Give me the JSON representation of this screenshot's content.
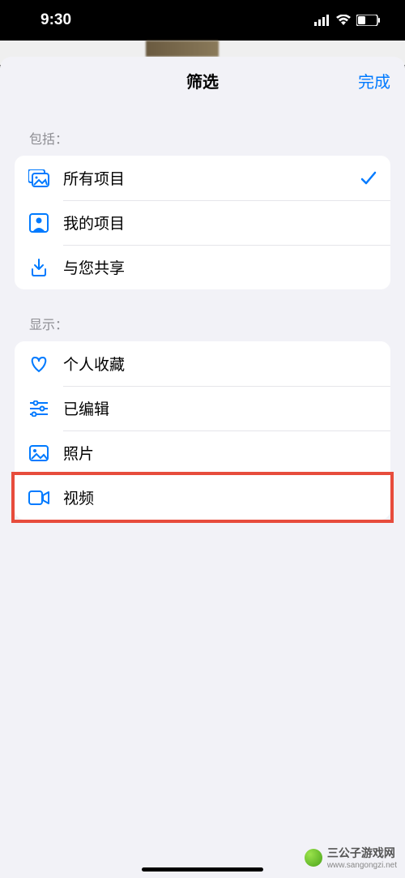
{
  "status": {
    "time": "9:30"
  },
  "sheet": {
    "title": "筛选",
    "done": "完成"
  },
  "sections": {
    "include": {
      "label": "包括：",
      "items": [
        {
          "label": "所有项目",
          "checked": true
        },
        {
          "label": "我的项目",
          "checked": false
        },
        {
          "label": "与您共享",
          "checked": false
        }
      ]
    },
    "show": {
      "label": "显示：",
      "items": [
        {
          "label": "个人收藏"
        },
        {
          "label": "已编辑"
        },
        {
          "label": "照片"
        },
        {
          "label": "视频"
        }
      ]
    }
  },
  "watermark": {
    "text": "三公子游戏网",
    "url": "www.sangongzi.net"
  }
}
